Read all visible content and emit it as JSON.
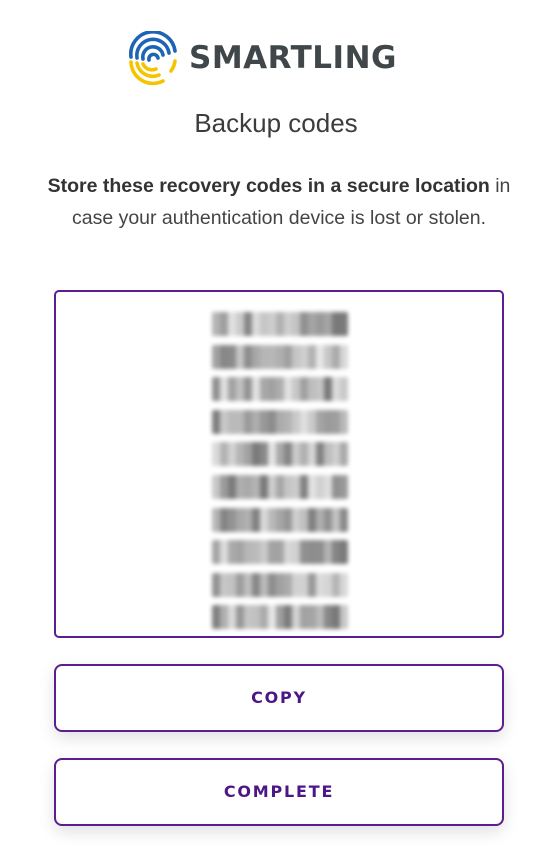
{
  "brand": {
    "name": "SMARTLING",
    "colors": {
      "blue": "#1e64b4",
      "yellow": "#f5c400",
      "text": "#3f474a"
    }
  },
  "page": {
    "title": "Backup codes",
    "description_bold": "Store these recovery codes in a secure location",
    "description_rest": " in case your authentication device is lost or stolen."
  },
  "codes": {
    "state": "blurred",
    "count": 10
  },
  "buttons": {
    "copy_label": "COPY",
    "complete_label": "COMPLETE"
  },
  "theme": {
    "accent": "#5b1e8f",
    "button_text": "#4d1686"
  }
}
